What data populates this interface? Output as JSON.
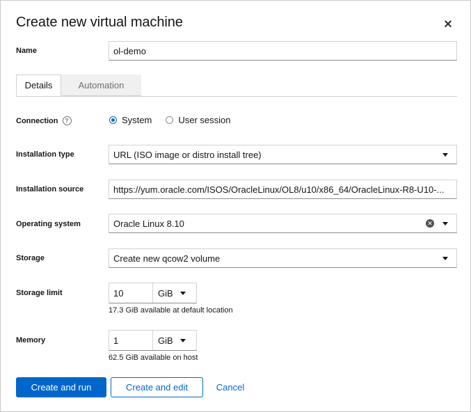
{
  "dialog": {
    "title": "Create new virtual machine",
    "close_icon": "close-icon"
  },
  "name": {
    "label": "Name",
    "value": "ol-demo"
  },
  "tabs": [
    {
      "label": "Details",
      "active": true
    },
    {
      "label": "Automation",
      "active": false
    }
  ],
  "connection": {
    "label": "Connection",
    "help_icon": "help-icon",
    "options": [
      {
        "label": "System",
        "selected": true
      },
      {
        "label": "User session",
        "selected": false
      }
    ]
  },
  "installation_type": {
    "label": "Installation type",
    "value": "URL (ISO image or distro install tree)"
  },
  "installation_source": {
    "label": "Installation source",
    "value": "https://yum.oracle.com/ISOS/OracleLinux/OL8/u10/x86_64/OracleLinux-R8-U10-..."
  },
  "operating_system": {
    "label": "Operating system",
    "value": "Oracle Linux 8.10"
  },
  "storage": {
    "label": "Storage",
    "value": "Create new qcow2 volume"
  },
  "storage_limit": {
    "label": "Storage limit",
    "value": "10",
    "unit": "GiB",
    "helper": "17.3 GiB available at default location"
  },
  "memory": {
    "label": "Memory",
    "value": "1",
    "unit": "GiB",
    "helper": "62.5 GiB available on host"
  },
  "footer": {
    "create_run_label": "Create and run",
    "create_edit_label": "Create and edit",
    "cancel_label": "Cancel"
  },
  "colors": {
    "accent": "#0066cc"
  }
}
